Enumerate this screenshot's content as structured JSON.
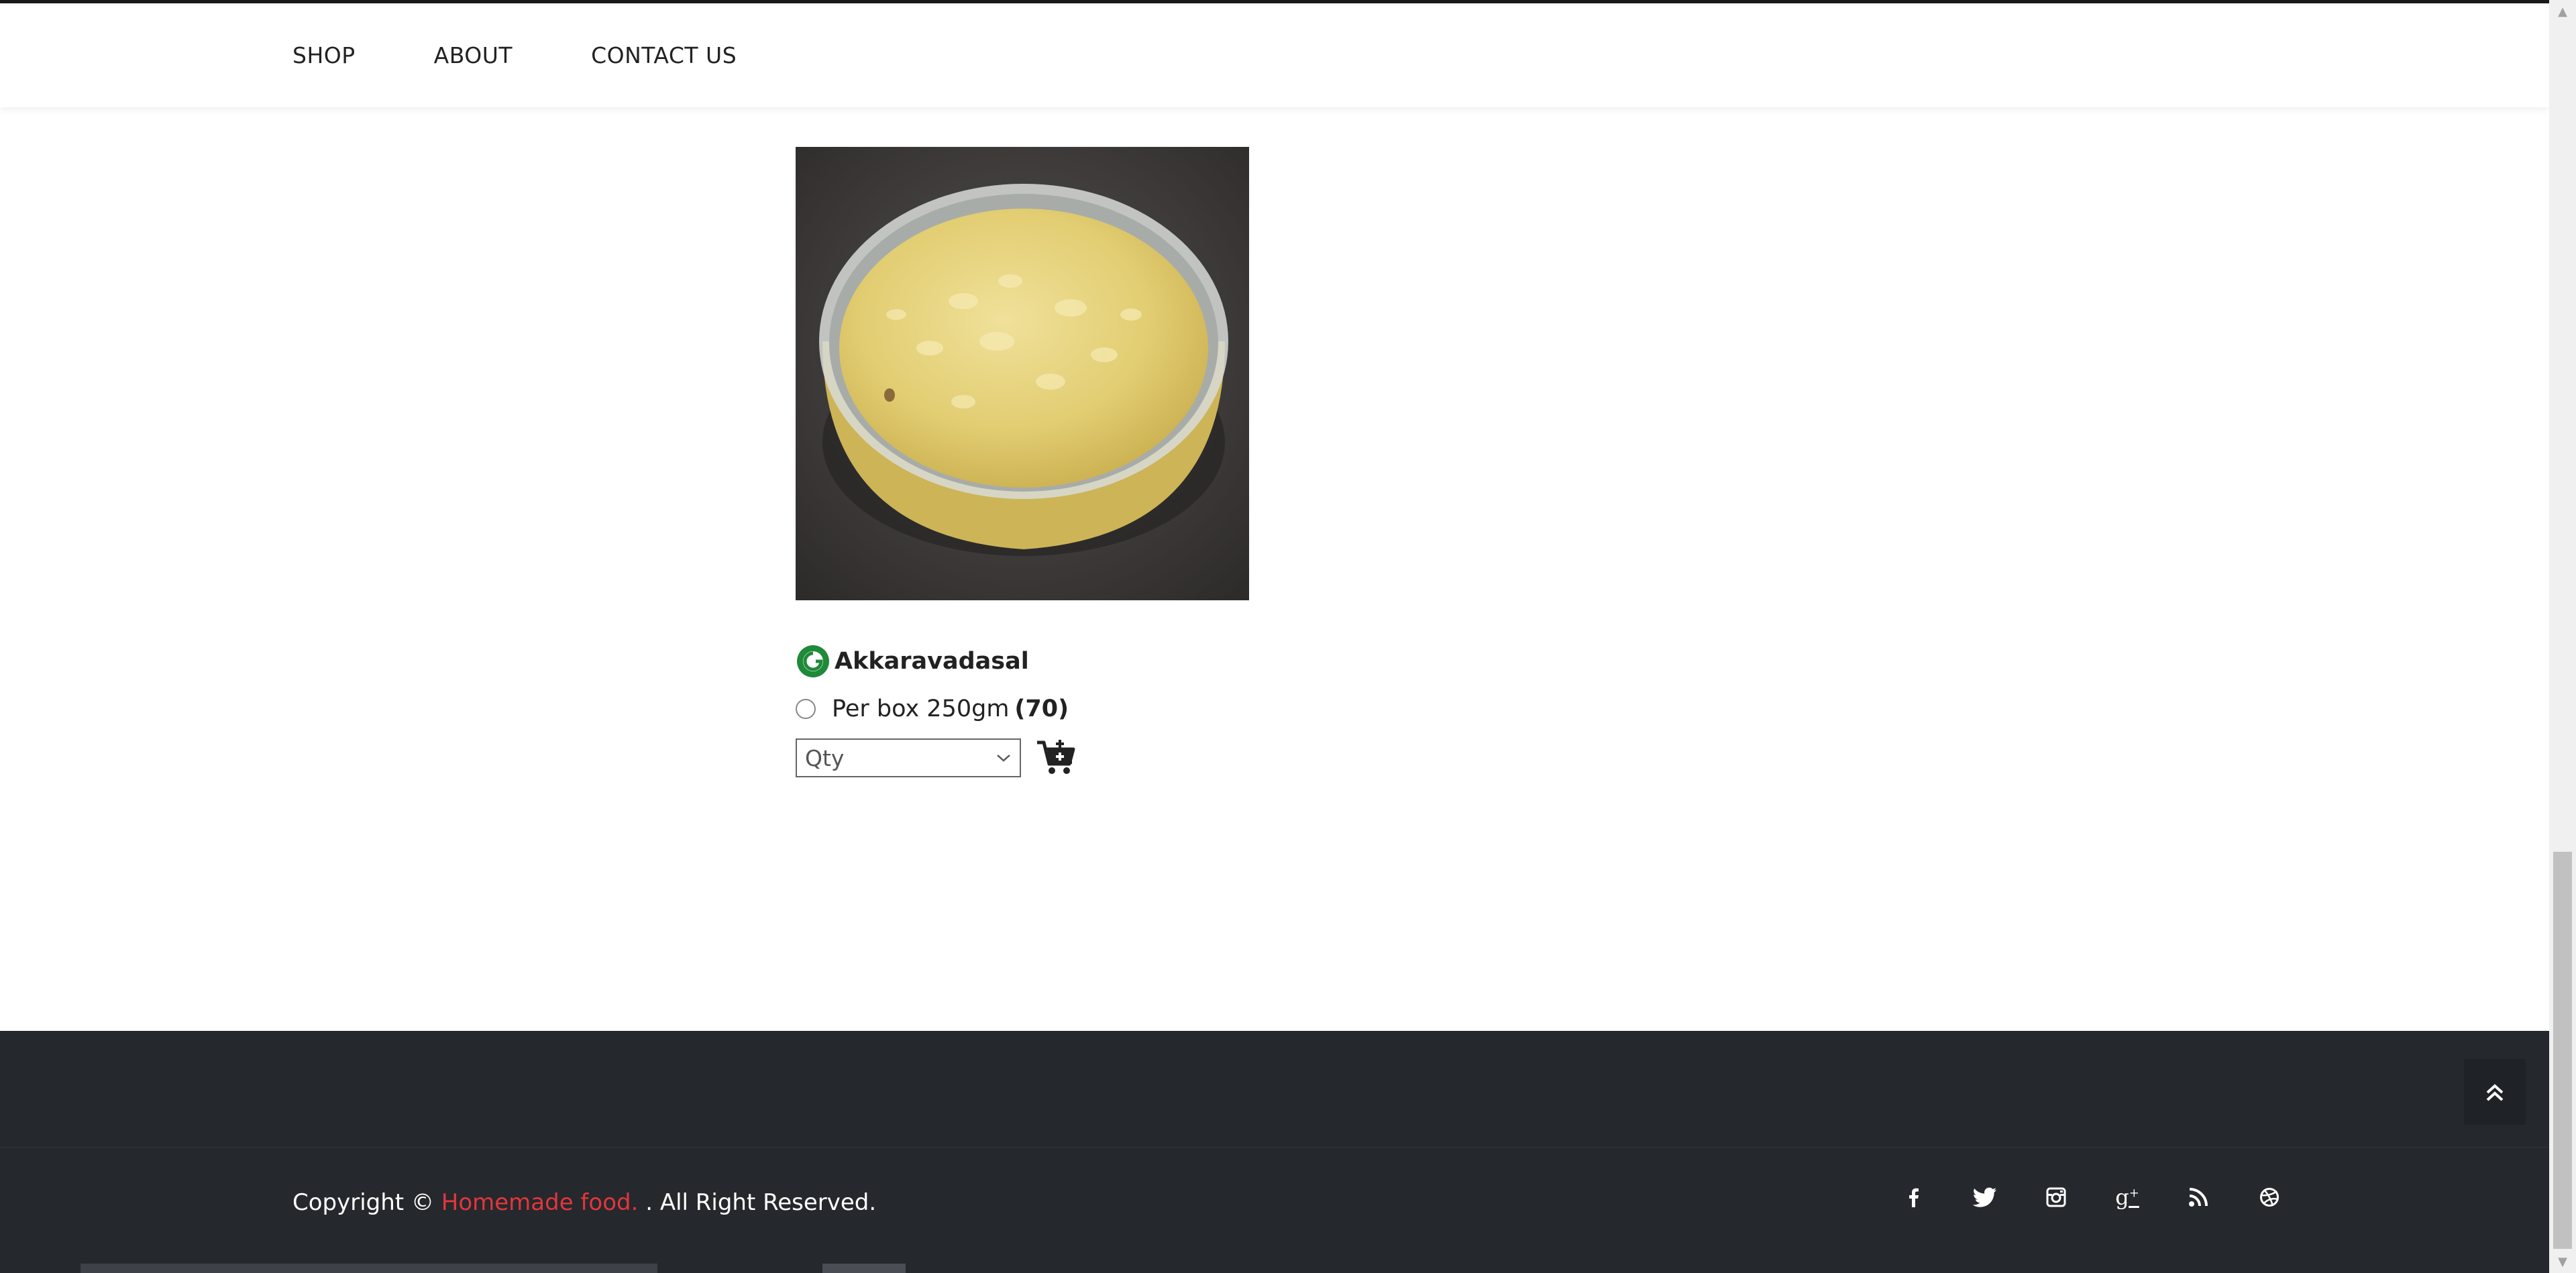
{
  "nav": {
    "items": [
      {
        "label": "SHOP"
      },
      {
        "label": "ABOUT"
      },
      {
        "label": "CONTACT US"
      }
    ]
  },
  "product": {
    "name": "Akkaravadasal",
    "variant_label": "Per box 250gm",
    "variant_price": "(70)",
    "qty_placeholder": "Qty",
    "badge_icon": "veg-badge-icon",
    "cart_icon": "add-to-cart-icon"
  },
  "footer": {
    "copyright_prefix": "Copyright © ",
    "brand": "Homemade food.",
    "copyright_suffix": " . All Right Reserved.",
    "socials": [
      "facebook-icon",
      "twitter-icon",
      "instagram-icon",
      "google-plus-icon",
      "rss-icon",
      "dribbble-icon"
    ]
  },
  "colors": {
    "footer_bg": "#25282c",
    "brand": "#e2363d",
    "badge_green": "#1f8a3a"
  }
}
